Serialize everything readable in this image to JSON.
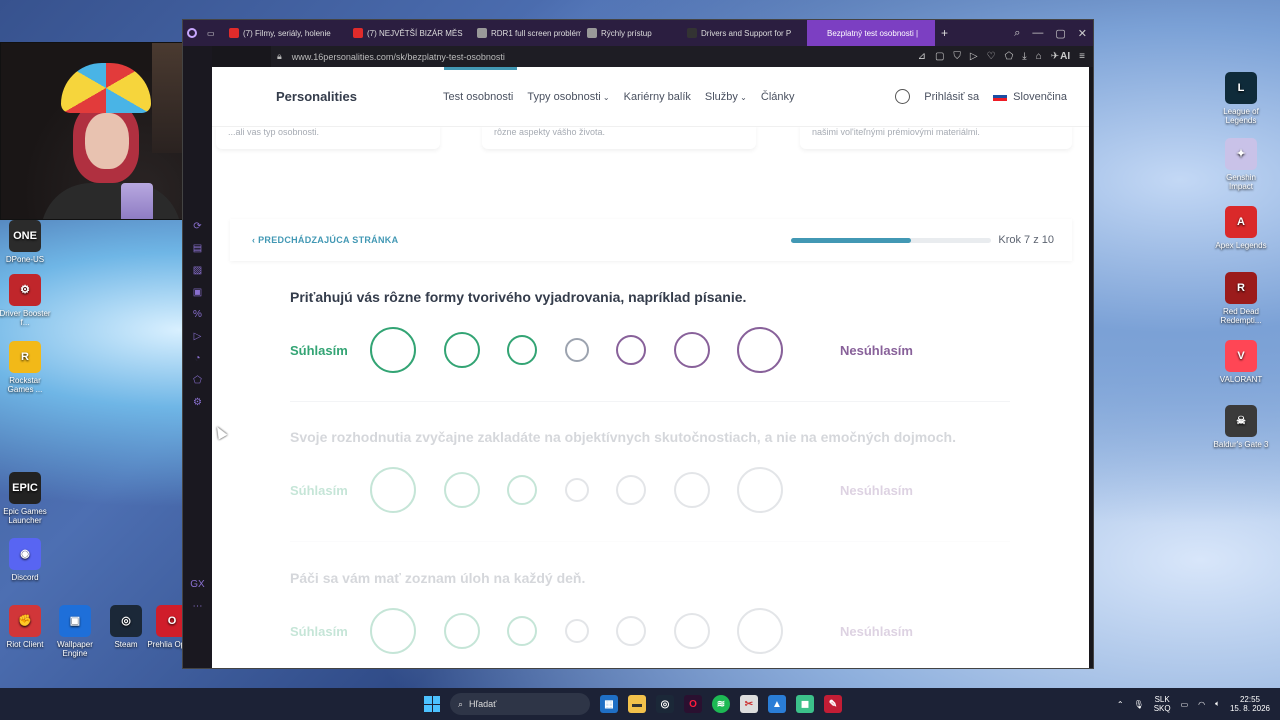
{
  "desktop": {
    "left_icons": [
      {
        "label": "DPone-US",
        "glyph": "ONE",
        "color": "#2b2b2b"
      },
      {
        "label": "Driver Booster f...",
        "glyph": "⚙",
        "color": "#c0262b"
      },
      {
        "label": "Rockstar Games ...",
        "glyph": "R",
        "color": "#f2b918"
      },
      {
        "label": "Epic Games Launcher",
        "glyph": "EPIC",
        "color": "#222"
      },
      {
        "label": "Discord",
        "glyph": "◉",
        "color": "#5865f2"
      }
    ],
    "bottom_icons": [
      {
        "label": "Riot Client",
        "glyph": "✊",
        "color": "#d13639"
      },
      {
        "label": "Wallpaper Engine",
        "glyph": "▣",
        "color": "#1e6fd9"
      },
      {
        "label": "Steam",
        "glyph": "◎",
        "color": "#1b2838"
      },
      {
        "label": "Prehlia Opera",
        "glyph": "O",
        "color": "#d01d2a"
      }
    ],
    "right_icons": [
      {
        "label": "League of Legends",
        "glyph": "L",
        "color": "#0f2b3a"
      },
      {
        "label": "Genshin Impact",
        "glyph": "✦",
        "color": "#c9c2e8"
      },
      {
        "label": "Apex Legends",
        "glyph": "A",
        "color": "#da292a"
      },
      {
        "label": "Red Dead Redempti...",
        "glyph": "R",
        "color": "#9b1b1b"
      },
      {
        "label": "VALORANT",
        "glyph": "V",
        "color": "#ff4655"
      },
      {
        "label": "Baldur's Gate 3",
        "glyph": "☠",
        "color": "#3a3a3a"
      }
    ]
  },
  "browser": {
    "tabs": [
      {
        "label": "(7) Filmy, seriály, holenie",
        "color": "#e02b2b"
      },
      {
        "label": "(7) NEJVĚTŠÍ BIZÁR MĚS",
        "color": "#e02b2b"
      },
      {
        "label": "RDR1 full screen problém",
        "color": "#999999"
      },
      {
        "label": "Rýchly prístup",
        "color": "#999999"
      },
      {
        "label": "Drivers and Support for P",
        "color": "#333333"
      },
      {
        "label": "Bezplatný test osobnosti |",
        "color": "#7c3fc2"
      }
    ],
    "url": "www.16personalities.com/sk/bezplatny-test-osobnosti",
    "tool_icons": [
      "pin-icon",
      "screenshot-icon",
      "shield-icon",
      "play-icon",
      "heart-icon",
      "extensions-icon",
      "download-icon",
      "wallet-icon",
      "aria-ai-icon",
      "menu-icon"
    ],
    "ai_label": "AI"
  },
  "site": {
    "brand": "Personalities",
    "nav": [
      "Test osobnosti",
      "Typy osobnosti",
      "Kariérny balík",
      "Služby",
      "Články"
    ],
    "login": "Prihlásiť sa",
    "language": "Slovenčina",
    "cards": [
      "...ali vas typ osobnosti.",
      "rôzne aspekty vášho života.",
      "našimi vol'iteľnými prémiovými materiálmi."
    ]
  },
  "progress": {
    "prev_label": "PREDCHÁDZAJÚCA STRÁNKA",
    "step_text": "Krok 7 z 10",
    "fraction": 0.6
  },
  "questions": [
    {
      "text": "Priťahujú vás rôzne formy tvorivého vyjadrovania, napríklad písanie.",
      "agree": "Súhlasím",
      "disagree": "Nesúhlasím",
      "active": true
    },
    {
      "text": "Svoje rozhodnutia zvyčajne zakladáte na objektívnych skutočnostiach, a nie na emočných dojmoch.",
      "agree": "Súhlasím",
      "disagree": "Nesúhlasím",
      "active": false
    },
    {
      "text": "Páči sa vám mať zoznam úloh na každý deň.",
      "agree": "Súhlasím",
      "disagree": "Nesúhlasím",
      "active": false
    }
  ],
  "colors": {
    "agree": "#33a474",
    "disagree": "#88619a",
    "neutral": "#9ca3af",
    "accent": "#4298b4"
  },
  "taskbar": {
    "search_placeholder": "Hľadať",
    "lang_top": "SLK",
    "lang_bottom": "SKQ",
    "time": "22:55",
    "date": "15. 8. 2026"
  }
}
